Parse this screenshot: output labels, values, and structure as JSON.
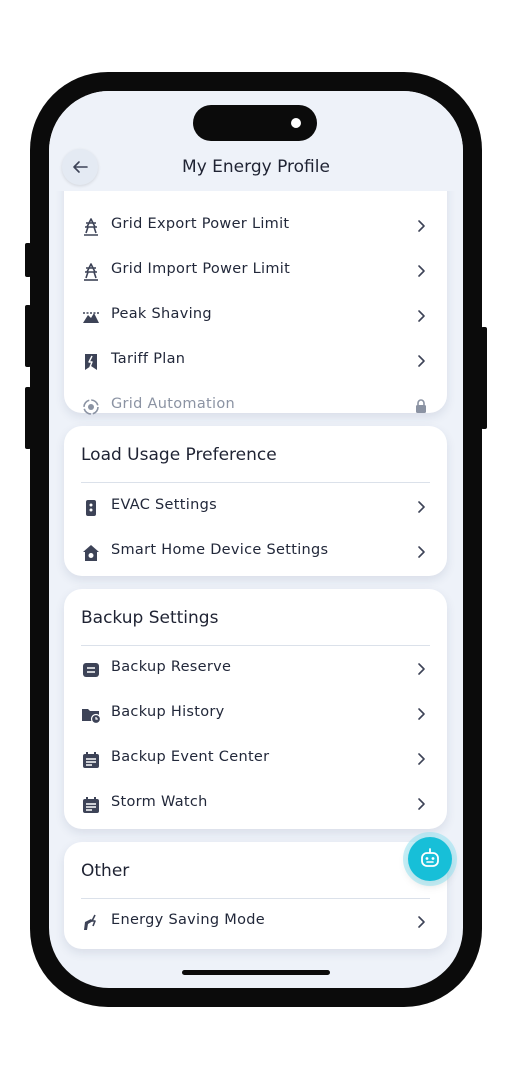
{
  "header": {
    "title": "My Energy Profile"
  },
  "grid_card": {
    "items": [
      {
        "label": "Grid Export Power Limit",
        "icon": "grid-export-icon",
        "disabled": false
      },
      {
        "label": "Grid Import Power Limit",
        "icon": "grid-import-icon",
        "disabled": false
      },
      {
        "label": "Peak Shaving",
        "icon": "peak-shaving-icon",
        "disabled": false
      },
      {
        "label": "Tariff Plan",
        "icon": "tariff-plan-icon",
        "disabled": false
      },
      {
        "label": "Grid Automation",
        "icon": "grid-automation-icon",
        "disabled": true,
        "trailing_icon": "lock-icon"
      }
    ]
  },
  "load_card": {
    "title": "Load Usage Preference",
    "items": [
      {
        "label": "EVAC Settings",
        "icon": "evac-icon"
      },
      {
        "label": "Smart Home Device Settings",
        "icon": "smart-home-icon"
      }
    ]
  },
  "backup_card": {
    "title": "Backup Settings",
    "items": [
      {
        "label": "Backup Reserve",
        "icon": "backup-reserve-icon"
      },
      {
        "label": "Backup History",
        "icon": "backup-history-icon"
      },
      {
        "label": "Backup Event Center",
        "icon": "backup-event-center-icon"
      },
      {
        "label": "Storm Watch",
        "icon": "storm-watch-icon"
      }
    ]
  },
  "other_card": {
    "title": "Other",
    "items": [
      {
        "label": "Energy Saving Mode",
        "icon": "energy-saving-icon"
      }
    ]
  },
  "colors": {
    "screen_background": "#eef2f9",
    "card_background": "#ffffff",
    "text_primary": "#1f2333",
    "icon_color": "#3d4357",
    "disabled_text": "#8b93a3",
    "fab": "#17bfd8"
  }
}
